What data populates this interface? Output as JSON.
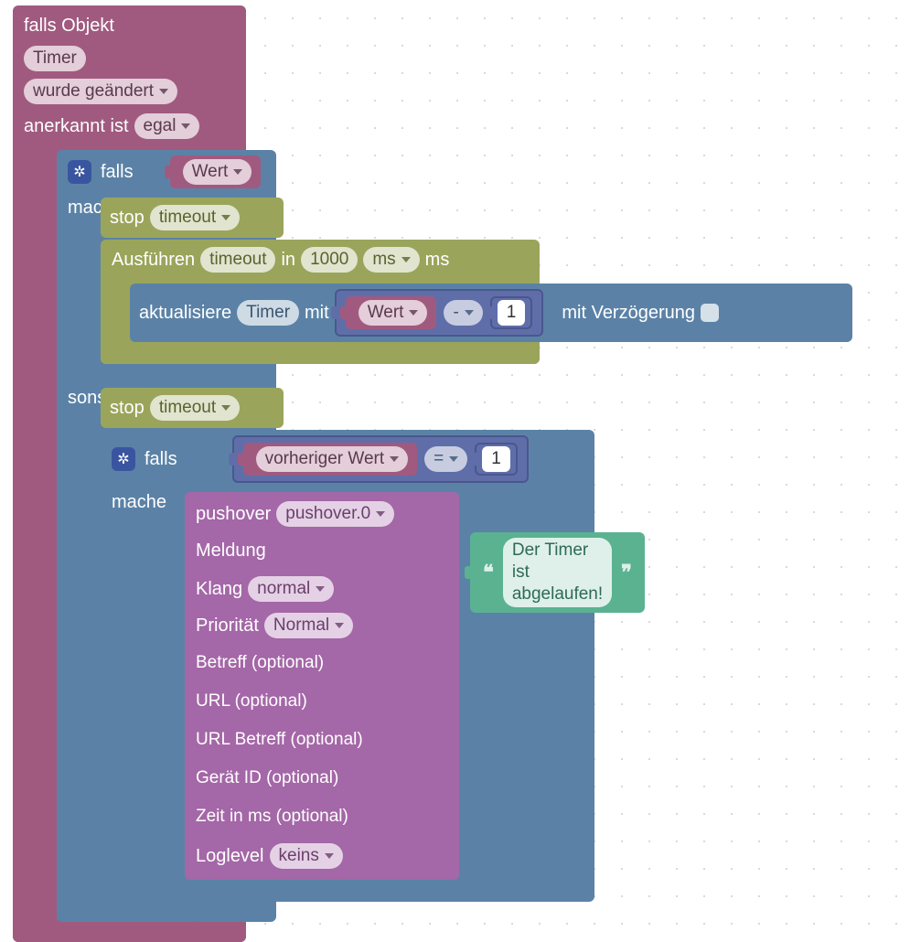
{
  "trigger": {
    "title_prefix": "falls Objekt",
    "object": "Timer",
    "event": "wurde geändert",
    "ack_label": "anerkannt ist",
    "ack_value": "egal"
  },
  "if1": {
    "if_label": "falls",
    "cond_value": "Wert",
    "do_label": "mache",
    "stop_label": "stop",
    "stop_name": "timeout",
    "exec_label": "Ausführen",
    "exec_name": "timeout",
    "exec_in": "in",
    "exec_time": "1000",
    "exec_unit": "ms",
    "exec_unit_after": "ms",
    "update": {
      "label": "aktualisiere",
      "state": "Timer",
      "with": "mit",
      "expr_left": "Wert",
      "expr_op": "-",
      "expr_right": "1",
      "delay_label": "mit Verzögerung"
    },
    "else_label": "sonst",
    "else_stop_label": "stop",
    "else_stop_name": "timeout"
  },
  "if2": {
    "if_label": "falls",
    "cond_left": "vorheriger Wert",
    "cond_op": "=",
    "cond_right": "1",
    "do_label": "mache"
  },
  "pushover": {
    "title": "pushover",
    "instance": "pushover.0",
    "rows": {
      "message_label": "Meldung",
      "message_value": "Der Timer ist abgelaufen!",
      "sound_label": "Klang",
      "sound_value": "normal",
      "priority_label": "Priorität",
      "priority_value": "Normal",
      "subject": "Betreff (optional)",
      "url": "URL (optional)",
      "url_title": "URL Betreff (optional)",
      "device": "Gerät ID (optional)",
      "time": "Zeit in ms (optional)",
      "loglevel_label": "Loglevel",
      "loglevel_value": "keins"
    }
  }
}
